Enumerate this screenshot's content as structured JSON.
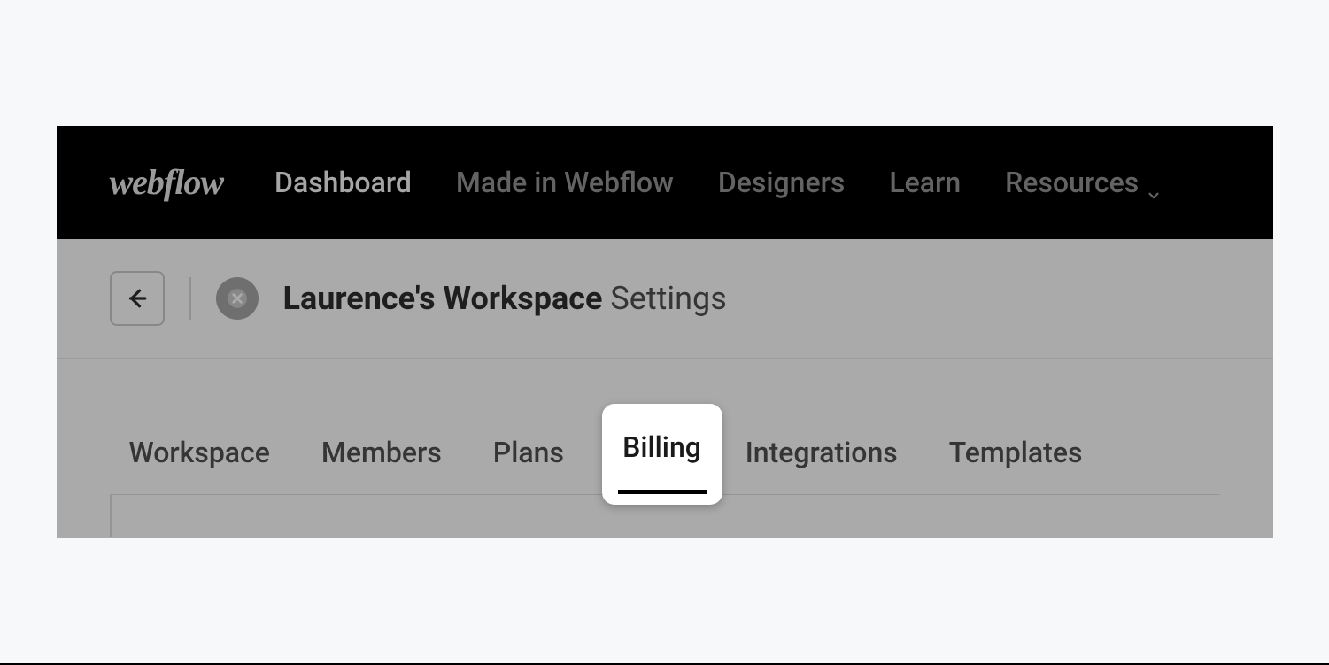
{
  "brand": "webflow",
  "nav": {
    "items": [
      {
        "label": "Dashboard",
        "active": true
      },
      {
        "label": "Made in Webflow",
        "active": false
      },
      {
        "label": "Designers",
        "active": false
      },
      {
        "label": "Learn",
        "active": false
      },
      {
        "label": "Resources",
        "active": false,
        "dropdown": true
      }
    ]
  },
  "breadcrumb": {
    "workspace_name": "Laurence's Workspace",
    "page": "Settings"
  },
  "tabs": {
    "items": [
      {
        "label": "Workspace",
        "active": false
      },
      {
        "label": "Members",
        "active": false
      },
      {
        "label": "Plans",
        "active": false
      },
      {
        "label": "Billing",
        "active": true
      },
      {
        "label": "Integrations",
        "active": false
      },
      {
        "label": "Templates",
        "active": false
      }
    ]
  }
}
